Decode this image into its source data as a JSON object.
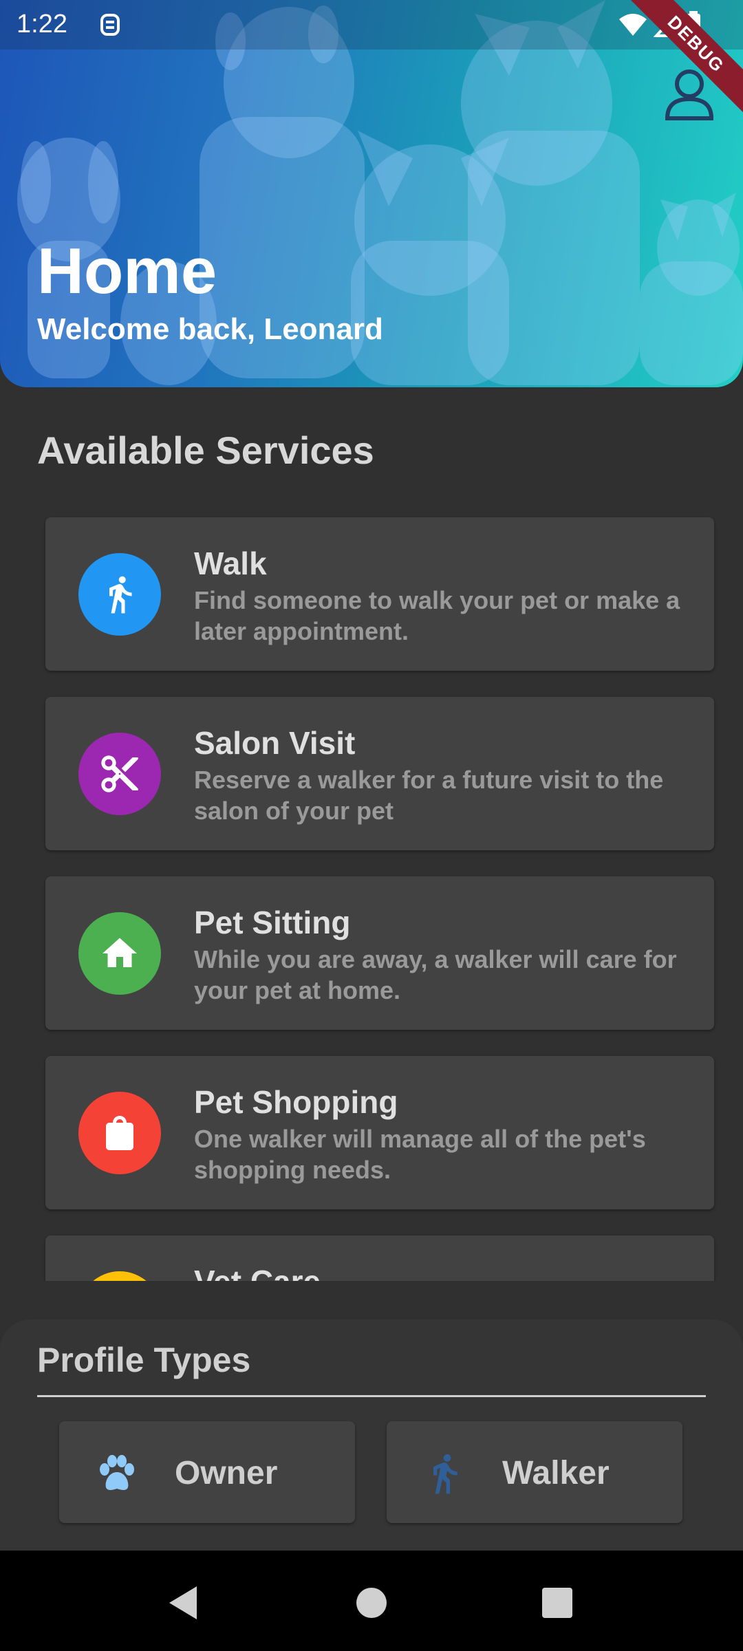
{
  "status": {
    "time": "1:22",
    "debug_label": "DEBUG"
  },
  "header": {
    "title": "Home",
    "subtitle": "Welcome back, Leonard"
  },
  "services": {
    "title": "Available Services",
    "items": [
      {
        "name": "Walk",
        "description": "Find someone to walk your pet or make a later appointment.",
        "icon": "walk-icon",
        "color": "#2196f3"
      },
      {
        "name": "Salon Visit",
        "description": "Reserve a walker for a future visit to the salon of your pet",
        "icon": "scissors-icon",
        "color": "#9c27b0"
      },
      {
        "name": "Pet Sitting",
        "description": "While you are away, a walker will care for your pet at home.",
        "icon": "home-icon",
        "color": "#4caf50"
      },
      {
        "name": "Pet Shopping",
        "description": "One walker will manage all of the pet's shopping needs.",
        "icon": "shopping-bag-icon",
        "color": "#f44336"
      },
      {
        "name": "Vet Care",
        "description": "",
        "icon": "vet-icon",
        "color": "#ffc107"
      }
    ]
  },
  "profile_types": {
    "title": "Profile Types",
    "items": [
      {
        "label": "Owner",
        "icon": "paw-icon",
        "color": "#90caf9"
      },
      {
        "label": "Walker",
        "icon": "walk-icon",
        "color": "#2f5f99"
      }
    ]
  }
}
